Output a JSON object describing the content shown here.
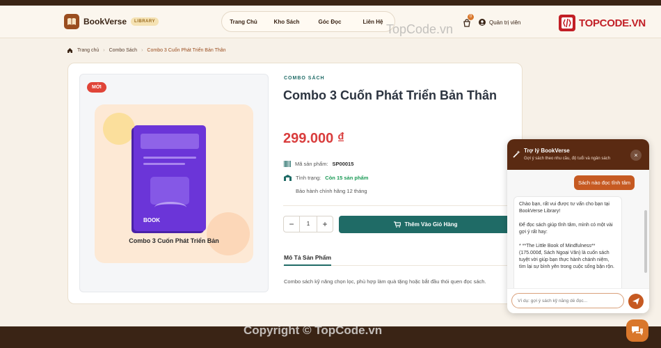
{
  "topbar": {
    "text": "... "
  },
  "header": {
    "brand": "BookVerse",
    "brand_badge": "LIBRARY",
    "nav": [
      "Trang Chủ",
      "Kho Sách",
      "Góc Đọc",
      "Liên Hệ"
    ],
    "cart_count": "0",
    "admin_label": "Quản trị viên"
  },
  "watermark": {
    "brand": "TOPCODE.VN",
    "center": "TopCode.vn",
    "footer": "Copyright © TopCode.vn"
  },
  "breadcrumb": {
    "home": "Trang chủ",
    "category": "Combo Sách",
    "current": "Combo 3 Cuốn Phát Triển Bản Thân"
  },
  "product": {
    "badge": "MỚI",
    "cover_label": "BOOK",
    "cover_title": "Combo 3 Cuốn Phát Triển Bản",
    "category": "COMBO SÁCH",
    "title": "Combo 3 Cuốn Phát Triển Bản Thân",
    "price": "299.000 ₫",
    "sku_label": "Mã sản phẩm:",
    "sku": "SP00015",
    "stock_label": "Tình trạng:",
    "stock": "Còn 15 sản phẩm",
    "warranty": "Bảo hành chính hãng 12 tháng",
    "qty": "1",
    "add_to_cart": "Thêm Vào Giỏ Hàng",
    "desc_tab": "Mô Tả Sản Phẩm",
    "description": "Combo sách kỹ năng chọn lọc, phù hợp làm quà tặng hoặc bắt đầu thói quen đọc sách."
  },
  "chat": {
    "title": "Trợ lý BookVerse",
    "subtitle": "Gợi ý sách theo nhu cầu, độ tuổi và ngân sách",
    "user_message": "Sách nào đọc tĩnh tâm",
    "bot_p1": "Chào bạn, rất vui được tư vấn cho bạn tại BookVerse Library!",
    "bot_p2": "Để đọc sách giúp tĩnh tâm, mình có một vài gợi ý rất hay:",
    "bot_p3": "* **The Little Book of Mindfulness** (175.000đ, Sách Ngoại Văn) là cuốn sách tuyệt vời giúp bạn thực hành chánh niệm, tìm lại sự bình yên trong cuộc sống bận rộn.",
    "input_placeholder": "Ví dụ: gợi ý sách kỹ năng dễ đọc..."
  },
  "colors": {
    "primary_teal": "#1f6b66",
    "price_red": "#d93d3d",
    "accent_orange": "#c65a22",
    "dark_brown": "#3a2415"
  }
}
